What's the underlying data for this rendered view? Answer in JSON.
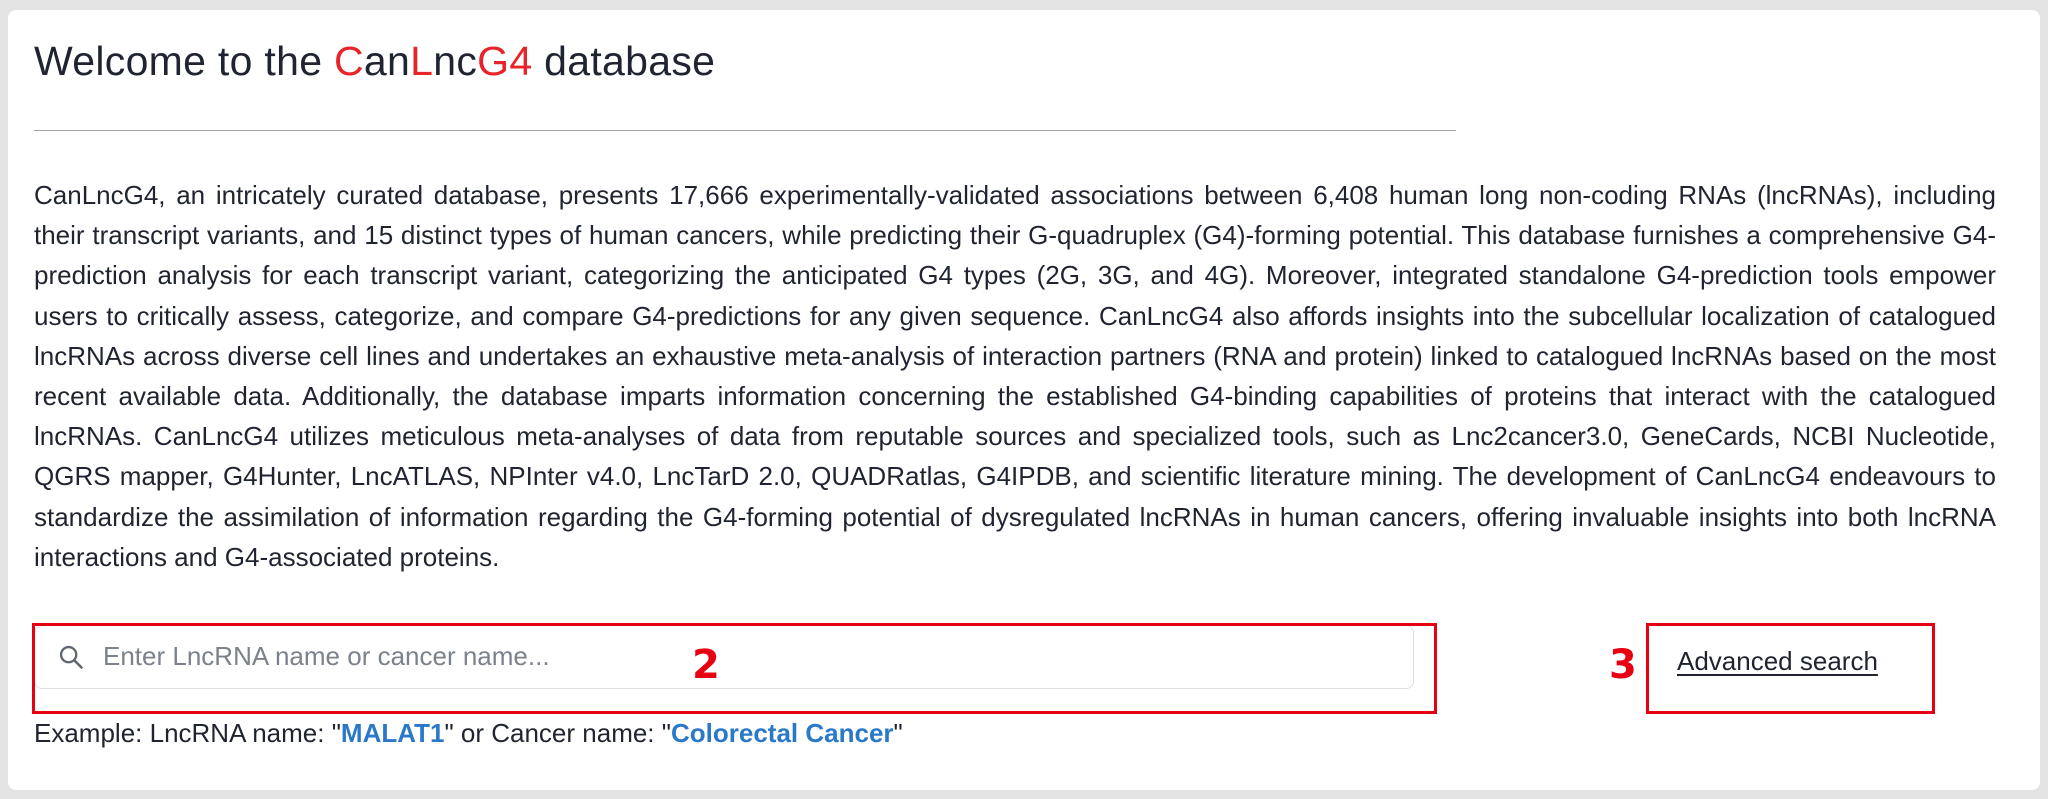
{
  "header": {
    "title_prefix": "Welcome to the ",
    "brand_c": "C",
    "brand_an": "an",
    "brand_l": "L",
    "brand_nc": "nc",
    "brand_g4": "G4",
    "title_suffix": " database"
  },
  "description": "CanLncG4, an intricately curated database, presents 17,666 experimentally-validated associations between 6,408 human long non-coding RNAs (lncRNAs), including their transcript variants, and 15 distinct types of human cancers, while predicting their G-quadruplex (G4)-forming potential. This database furnishes a comprehensive G4-prediction analysis for each transcript variant, categorizing the anticipated G4 types (2G, 3G, and 4G). Moreover, integrated standalone G4-prediction tools empower users to critically assess, categorize, and compare G4-predictions for any given sequence. CanLncG4 also affords insights into the subcellular localization of catalogued lncRNAs across diverse cell lines and undertakes an exhaustive meta-analysis of interaction partners (RNA and protein) linked to catalogued lncRNAs based on the most recent available data. Additionally, the database imparts information concerning the established G4-binding capabilities of proteins that interact with the catalogued lncRNAs. CanLncG4 utilizes meticulous meta-analyses of data from reputable sources and specialized tools, such as Lnc2cancer3.0, GeneCards, NCBI Nucleotide, QGRS mapper, G4Hunter, LncATLAS, NPInter v4.0, LncTarD 2.0, QUADRatlas, G4IPDB, and scientific literature mining. The development of CanLncG4 endeavours to standardize the assimilation of information regarding the G4-forming potential of dysregulated lncRNAs in human cancers, offering invaluable insights into both lncRNA interactions and G4-associated proteins.",
  "search": {
    "placeholder": "Enter LncRNA name or cancer name...",
    "value": "",
    "icon": "search-icon"
  },
  "advanced_search_label": "Advanced search",
  "example": {
    "prefix": "Example: LncRNA name: \"",
    "lncrna": "MALAT1",
    "middle": "\" or Cancer name: \"",
    "cancer": "Colorectal Cancer",
    "suffix": "\""
  },
  "annotations": {
    "search_number": "2",
    "advanced_number": "3"
  },
  "colors": {
    "brand_red": "#e8242a",
    "link_blue": "#2a78c8",
    "annotation_red": "#e60012",
    "text": "#1f2430"
  }
}
